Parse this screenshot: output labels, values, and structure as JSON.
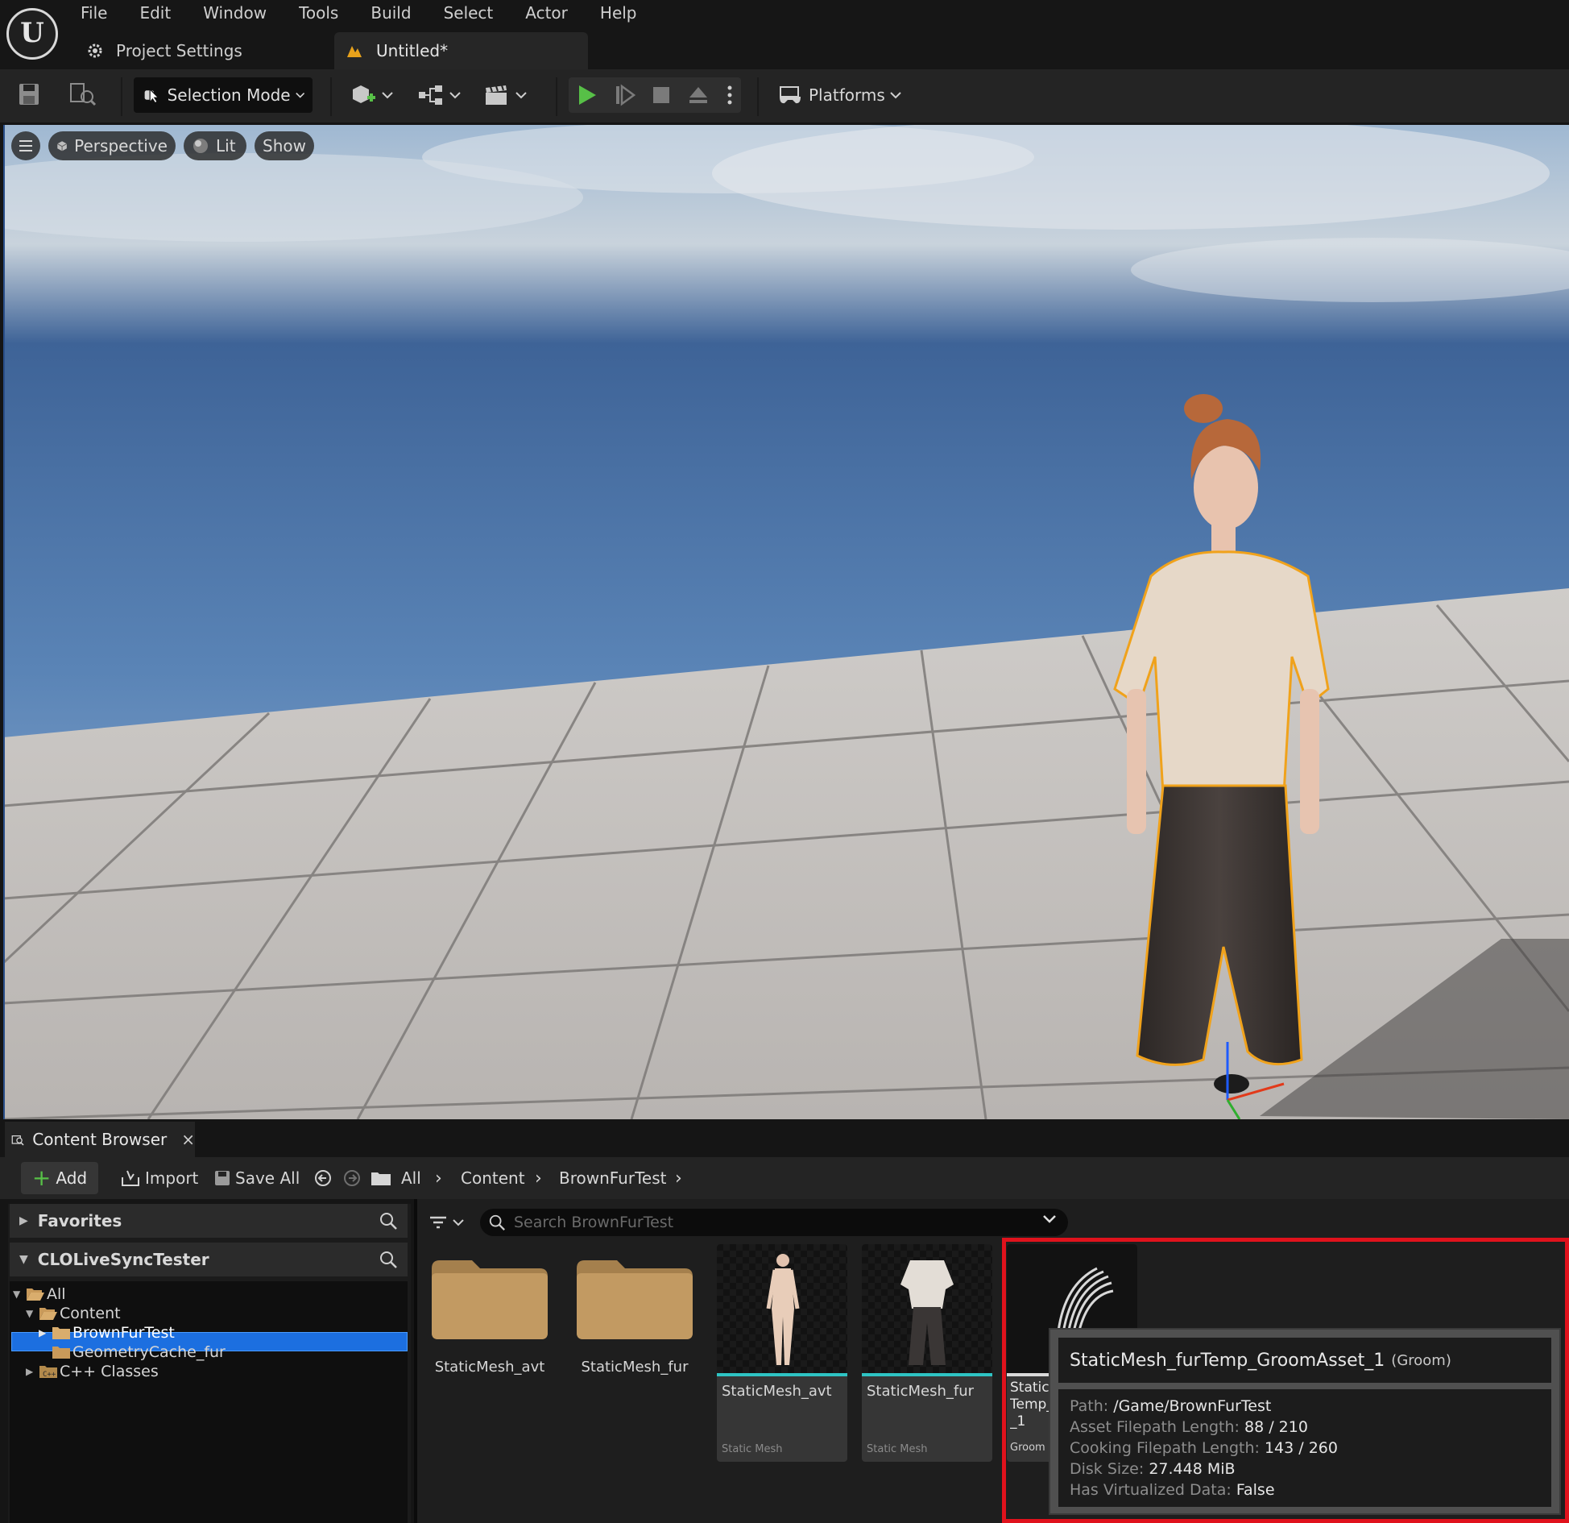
{
  "menu": [
    "File",
    "Edit",
    "Window",
    "Tools",
    "Build",
    "Select",
    "Actor",
    "Help"
  ],
  "project_settings_label": "Project Settings",
  "document_tab": "Untitled*",
  "toolbar": {
    "selection_mode": "Selection Mode",
    "platforms": "Platforms"
  },
  "viewport": {
    "perspective": "Perspective",
    "lit": "Lit",
    "show": "Show",
    "sky_color": "#5e87b8",
    "floor_color": "#c9c6c3"
  },
  "content_browser": {
    "tab_title": "Content Browser",
    "close": "×",
    "add": "Add",
    "import": "Import",
    "save_all": "Save All",
    "breadcrumb": [
      "All",
      "Content",
      "BrownFurTest"
    ],
    "favorites": "Favorites",
    "project_section": "CLOLiveSyncTester",
    "tree": [
      "All",
      "Content",
      "BrownFurTest",
      "GeometryCache_fur",
      "C++ Classes"
    ],
    "search_placeholder": "Search BrownFurTest",
    "folders": [
      "StaticMesh_avt",
      "StaticMesh_fur"
    ],
    "assets": [
      {
        "name": "StaticMesh_avt",
        "type": "Static Mesh"
      },
      {
        "name": "StaticMesh_fur",
        "type": "Static Mesh"
      }
    ],
    "groom_card": {
      "name_lines": [
        "Static",
        "Temp_",
        "_1"
      ],
      "type": "Groom"
    }
  },
  "tooltip": {
    "title": "StaticMesh_furTemp_GroomAsset_1",
    "type": "(Groom)",
    "rows": [
      {
        "key": "Path:",
        "value": "/Game/BrownFurTest"
      },
      {
        "key": "Asset Filepath Length:",
        "value": "88 / 210"
      },
      {
        "key": "Cooking Filepath Length:",
        "value": "143 / 260"
      },
      {
        "key": "Disk Size:",
        "value": "27.448 MiB"
      },
      {
        "key": "Has Virtualized Data:",
        "value": "False"
      }
    ]
  },
  "colors": {
    "accent_blue": "#1c6fe0",
    "play_green": "#57c047",
    "highlight_red": "#e0121c",
    "folder_tan": "#b8915a"
  }
}
